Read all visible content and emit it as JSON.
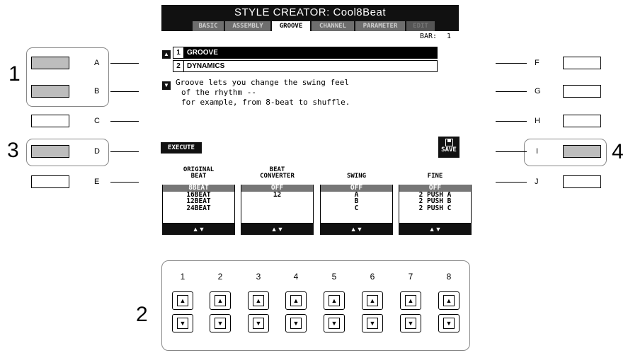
{
  "lcd": {
    "title": "STYLE CREATOR: Cool8Beat",
    "tabs": [
      "BASIC",
      "ASSEMBLY",
      "GROOVE",
      "CHANNEL",
      "PARAMETER",
      "EDIT"
    ],
    "bar_label": "BAR:",
    "bar_value": "1",
    "menu": [
      {
        "num": "1",
        "label": "GROOVE"
      },
      {
        "num": "2",
        "label": "DYNAMICS"
      }
    ],
    "description": [
      "Groove lets you change the swing feel",
      "of the rhythm --",
      "for example, from 8-beat to shuffle."
    ],
    "execute_label": "EXECUTE",
    "save_label": "SAVE",
    "columns": [
      {
        "head1": "ORIGINAL",
        "head2": "BEAT",
        "values": [
          "8BEAT",
          "16BEAT",
          "12BEAT",
          "24BEAT"
        ]
      },
      {
        "head1": "BEAT",
        "head2": "CONVERTER",
        "values": [
          "OFF",
          "12",
          "",
          ""
        ]
      },
      {
        "head1": "",
        "head2": "SWING",
        "values": [
          "OFF",
          "A",
          "B",
          "C"
        ]
      },
      {
        "head1": "",
        "head2": "FINE",
        "values": [
          "OFF",
          "2 PUSH A",
          "2 PUSH B",
          "2 PUSH C"
        ]
      }
    ],
    "column_arrow": "▲▼"
  },
  "left_buttons": [
    "A",
    "B",
    "C",
    "D",
    "E"
  ],
  "right_buttons": [
    "F",
    "G",
    "H",
    "I",
    "J"
  ],
  "callouts": {
    "left_top": "1",
    "left_mid": "3",
    "right": "4",
    "bottom": "2"
  },
  "bottom_buttons": [
    "1",
    "2",
    "3",
    "4",
    "5",
    "6",
    "7",
    "8"
  ],
  "glyphs": {
    "up": "▲",
    "down": "▼"
  }
}
